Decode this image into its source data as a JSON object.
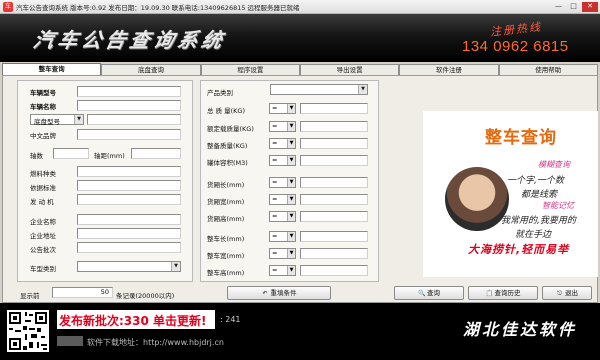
{
  "window": {
    "title": "汽车公告查询系统  版本号:0.92 发布日期：19.09.30  联系电话:13409626815  远程服务器已就绪",
    "buttons": [
      "—",
      "□",
      "✕"
    ]
  },
  "banner": {
    "brand_text": "汽车公告查询系统",
    "hotline_label": "注册热线",
    "hotline_phone": "134 0962 6815"
  },
  "tabs": [
    {
      "label": "整车查询",
      "active": true
    },
    {
      "label": "底盘查询",
      "active": false
    },
    {
      "label": "程序设置",
      "active": false
    },
    {
      "label": "导出设置",
      "active": false
    },
    {
      "label": "软件注册",
      "active": false
    },
    {
      "label": "使用帮助",
      "active": false
    }
  ],
  "left_form": {
    "vehicle_model": "车辆型号",
    "vehicle_name": "车辆名称",
    "chassis_model_select": "底盘型号",
    "cn_brand": "中文品牌",
    "axle_count": "轴数",
    "wheelbase": "轴距(mm)",
    "fuel_type": "燃料种类",
    "emission_std": "依据标准",
    "engine": "发 动 机",
    "company_name": "企业名称",
    "company_addr": "企业地址",
    "batch": "公告批次",
    "vehicle_category": "车型类别"
  },
  "mid_form": {
    "product_category": "产品类别",
    "total_mass": "总 质 量(KG)",
    "rated_load": "额定载质量(KG)",
    "curb_mass": "整备质量(KG)",
    "tank_volume": "罐体容积(M3)",
    "cargo_length": "货厢长(mm)",
    "cargo_width": "货厢宽(mm)",
    "cargo_height": "货厢高(mm)",
    "veh_length": "整车长(mm)",
    "veh_width": "整车宽(mm)",
    "veh_height": "整车高(mm)",
    "operator": "="
  },
  "results": {
    "label": "显示前",
    "value": "50",
    "suffix": "条记录(20000以内)"
  },
  "buttons": {
    "reset": "重填条件",
    "query": "查询",
    "history": "查询历史",
    "exit": "退出",
    "reset_icon": "↶",
    "query_icon": "🔍",
    "history_icon": "📋",
    "exit_icon": "⎋"
  },
  "ad": {
    "title": "整车查询",
    "lines": [
      "模糊查询",
      "一个字,一个数",
      "都是线索",
      "智能记忆",
      "我常用的,我要用的",
      "就在手边"
    ],
    "slogan": "大海捞针,轻而易举"
  },
  "footer": {
    "update_notice": "发布新批次:330 单击更新!",
    "batch_count": ": 241",
    "download": "软件下载地址：http://www.hbjdrj.cn",
    "company": "湖北佳达软件"
  }
}
